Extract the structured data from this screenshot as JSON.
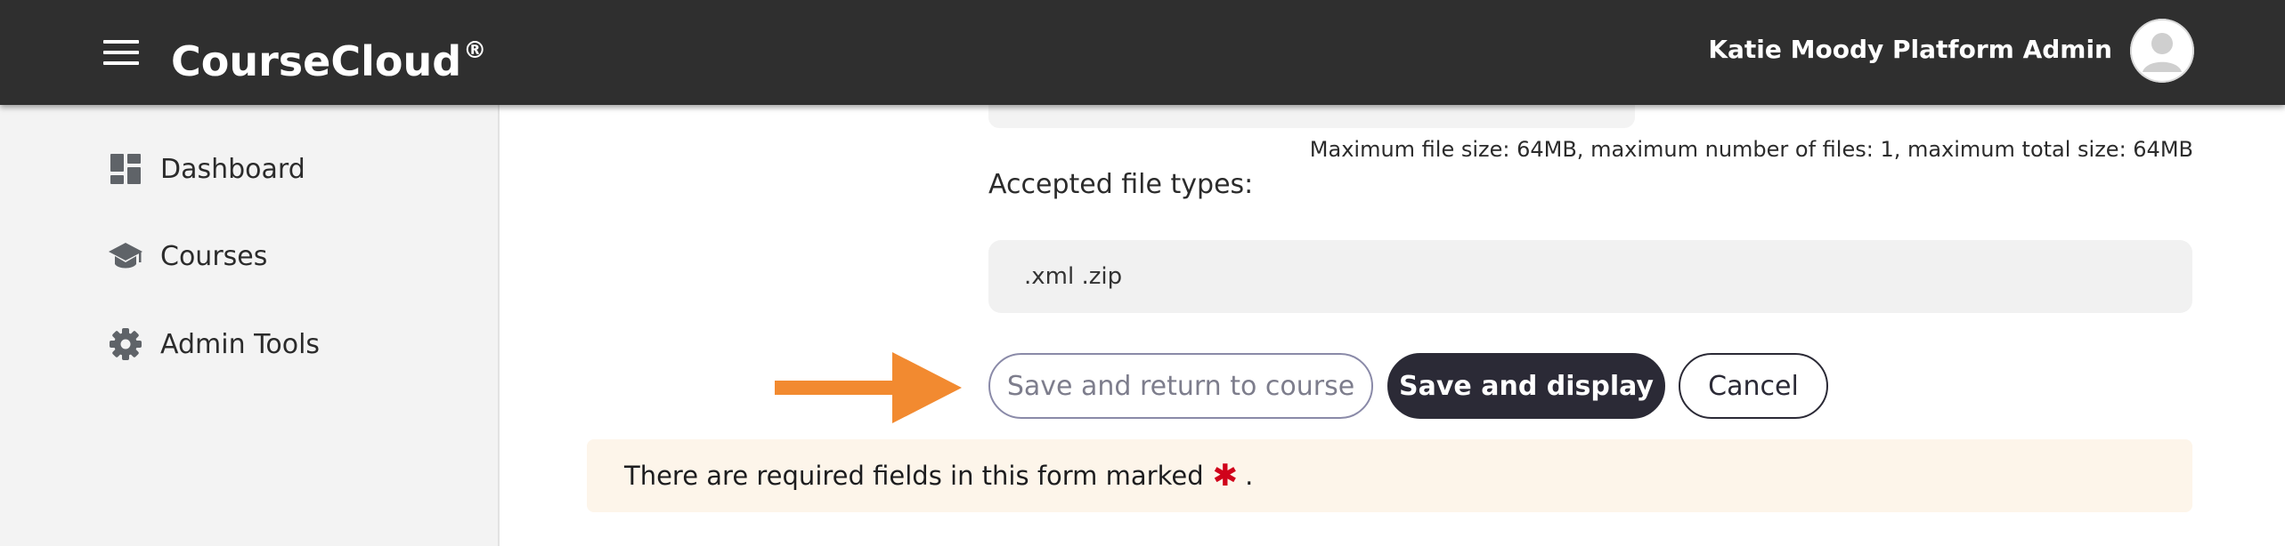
{
  "header": {
    "brand": "CourseCloud",
    "brand_mark": "®",
    "user_name": "Katie Moody Platform Admin",
    "menu_icon": "hamburger-menu-icon",
    "avatar_icon": "user-avatar-icon"
  },
  "sidebar": {
    "items": [
      {
        "label": "Dashboard",
        "icon": "dashboard-icon"
      },
      {
        "label": "Courses",
        "icon": "graduation-cap-icon"
      },
      {
        "label": "Admin Tools",
        "icon": "gear-icon"
      }
    ]
  },
  "form": {
    "file_limits": "Maximum file size: 64MB, maximum number of files: 1, maximum total size: 64MB",
    "accepted_label": "Accepted file types:",
    "accepted_types": ".xml .zip",
    "buttons": {
      "save_return": "Save and return to course",
      "save_display": "Save and display",
      "cancel": "Cancel"
    },
    "required_notice": "There are required fields in this form marked",
    "required_marker": "✱",
    "required_notice_end": "."
  },
  "colors": {
    "topbar": "#2f2f2f",
    "arrow": "#f28a30",
    "primary_button": "#2b2a36",
    "notice_bg": "#fdf5ea",
    "required_star": "#d0021b"
  }
}
